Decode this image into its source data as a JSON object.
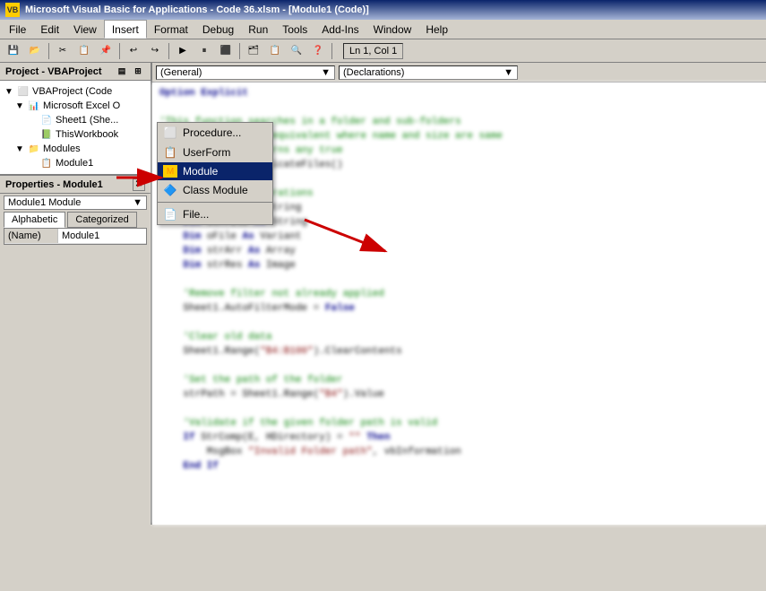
{
  "titlebar": {
    "text": "Microsoft Visual Basic for Applications - Code 36.xlsm - [Module1 (Code)]"
  },
  "menubar": {
    "items": [
      {
        "label": "File",
        "id": "file"
      },
      {
        "label": "Edit",
        "id": "edit"
      },
      {
        "label": "View",
        "id": "view"
      },
      {
        "label": "Insert",
        "id": "insert",
        "active": true
      },
      {
        "label": "Format",
        "id": "format"
      },
      {
        "label": "Debug",
        "id": "debug"
      },
      {
        "label": "Run",
        "id": "run"
      },
      {
        "label": "Tools",
        "id": "tools"
      },
      {
        "label": "Add-Ins",
        "id": "addins"
      },
      {
        "label": "Window",
        "id": "window"
      },
      {
        "label": "Help",
        "id": "help"
      }
    ]
  },
  "toolbar": {
    "status": "Ln 1, Col 1"
  },
  "insert_menu": {
    "items": [
      {
        "label": "Procedure...",
        "icon": "proc",
        "id": "procedure"
      },
      {
        "label": "UserForm",
        "icon": "form",
        "id": "userform"
      },
      {
        "label": "Module",
        "icon": "module",
        "id": "module",
        "highlighted": true
      },
      {
        "label": "Class Module",
        "icon": "class",
        "id": "classmodule"
      },
      {
        "label": "File...",
        "icon": "file",
        "id": "file"
      }
    ]
  },
  "project_panel": {
    "title": "Project - VBAProject",
    "tree": [
      {
        "label": "VBAProject (Code",
        "indent": 0,
        "expand": "▼",
        "icon": "vba"
      },
      {
        "label": "Microsoft Excel O",
        "indent": 1,
        "expand": "▼",
        "icon": "excel"
      },
      {
        "label": "Sheet1 (She...",
        "indent": 2,
        "expand": "",
        "icon": "sheet"
      },
      {
        "label": "ThisWorkbook",
        "indent": 2,
        "expand": "",
        "icon": "wb"
      },
      {
        "label": "Modules",
        "indent": 1,
        "expand": "▼",
        "icon": "folder"
      },
      {
        "label": "Module1",
        "indent": 2,
        "expand": "",
        "icon": "module"
      }
    ]
  },
  "properties_panel": {
    "title": "Properties - Module1",
    "dropdown_value": "Module1 Module",
    "tabs": [
      "Alphabetic",
      "Categorized"
    ],
    "active_tab": "Alphabetic",
    "rows": [
      {
        "key": "(Name)",
        "value": "Module1"
      }
    ]
  },
  "code_panel": {
    "object_dropdown": "(General)",
    "code_lines": [
      "Option Explicit",
      "",
      "'This function searches in a folder and sub-folders",
      "'and each the file equivalent where name and size are same",
      "'Once the code returns any true",
      "Public Sub FindDuplicateFiles()",
      "",
      "    'Variable Declarations",
      "    Dim strPth As String",
      "    Dim strFile As String",
      "    Dim oFile As Variant",
      "    Dim strArr As Array",
      "    Dim strRes As Image",
      "",
      "    'Remove filter not already applied",
      "    Sheet1.AutoFilterMode = False",
      "",
      "    'Clear old data",
      "    Sheet1.Range(\"B4:B100\").ClearContents",
      "",
      "    'Set the path of the folder",
      "    strPath = Sheet1.Range(\"B4\").Value",
      "",
      "    'Validate if the given folder path is valid",
      "    If StrComp(E, HDirectory) = \"\" Then",
      "        MsgBox \"Invalid Folder path\", vbInformation",
      "    End If"
    ]
  }
}
